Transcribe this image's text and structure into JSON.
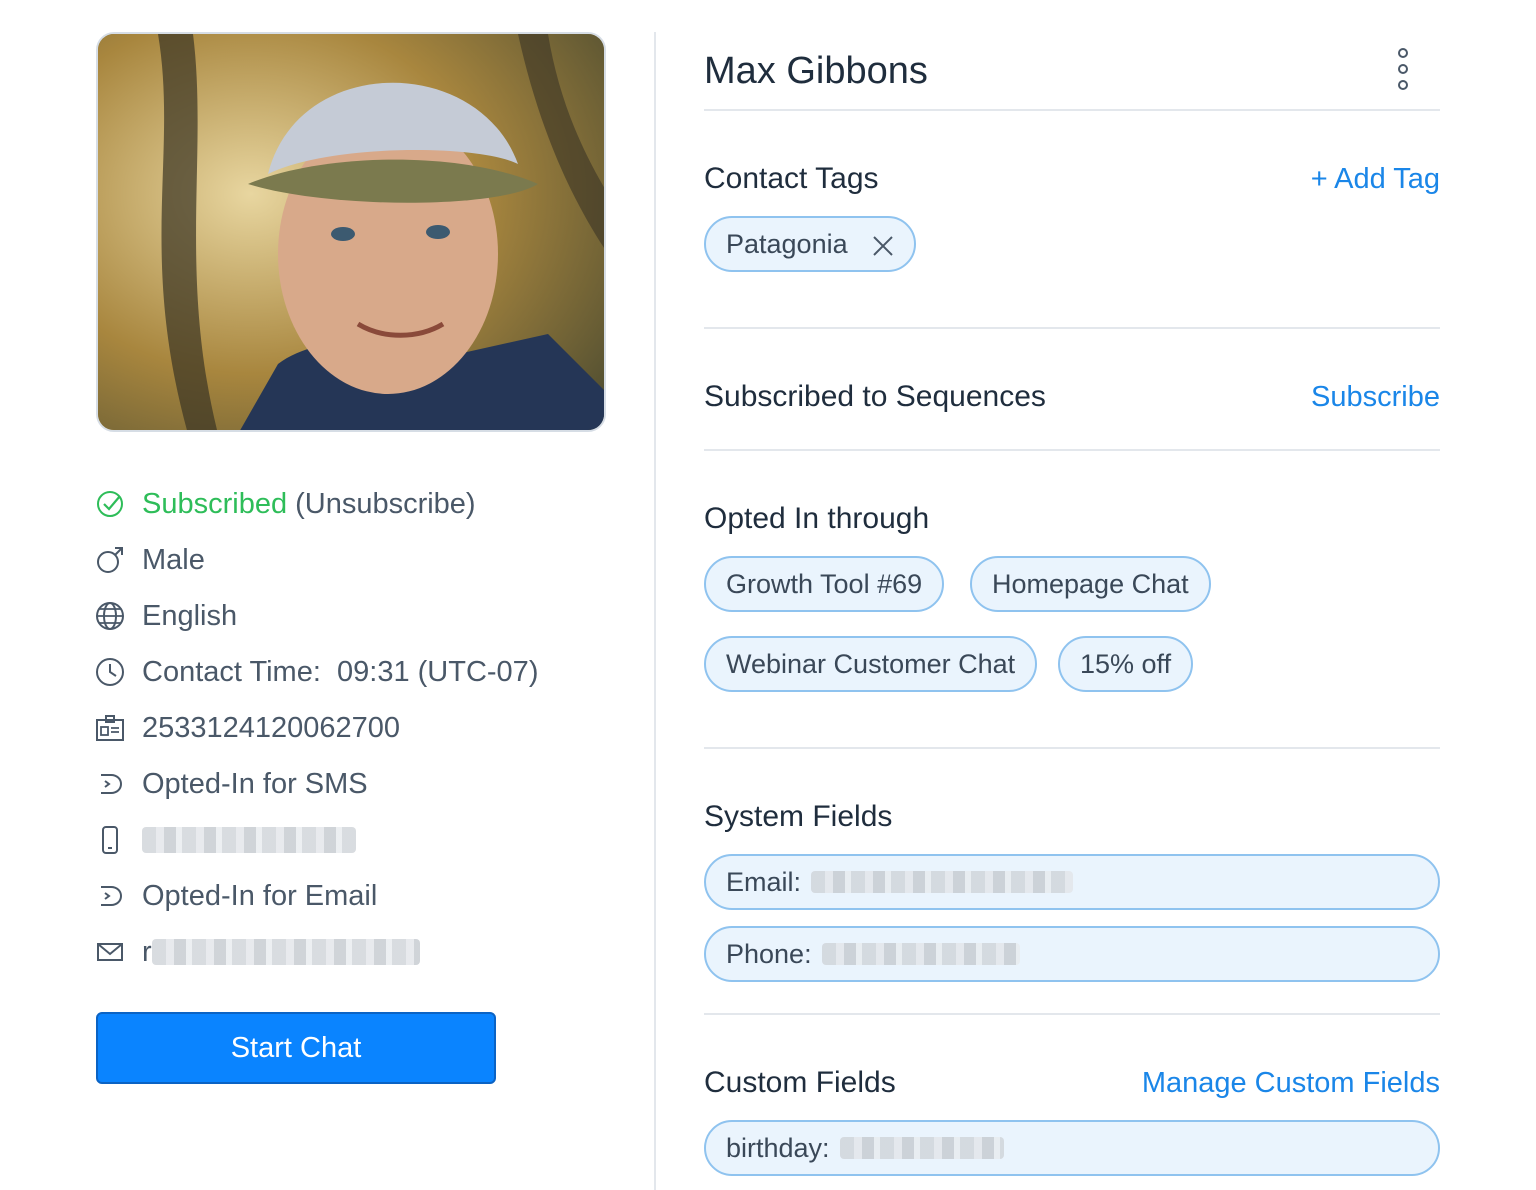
{
  "profile": {
    "subscribed_label": "Subscribed",
    "unsubscribe_label": "(Unsubscribe)",
    "gender": "Male",
    "language": "English",
    "contact_time": "Contact Time:  09:31 (UTC-07)",
    "contact_id": "2533124120062700",
    "sms_optin": "Opted-In for SMS",
    "email_optin": "Opted-In for Email",
    "email_prefix": "r",
    "start_chat_label": "Start Chat"
  },
  "header": {
    "name": "Max Gibbons"
  },
  "contact_tags": {
    "title": "Contact Tags",
    "add_label": "+ Add Tag",
    "tags": [
      "Patagonia"
    ]
  },
  "sequences": {
    "title": "Subscribed to Sequences",
    "link_label": "Subscribe"
  },
  "opted_in": {
    "title": "Opted In through",
    "items": [
      "Growth Tool #69",
      "Homepage Chat",
      "Webinar Customer Chat",
      "15% off"
    ]
  },
  "system_fields": {
    "title": "System Fields",
    "email_label": "Email:",
    "phone_label": "Phone:"
  },
  "custom_fields": {
    "title": "Custom Fields",
    "link_label": "Manage Custom Fields",
    "birthday_label": "birthday:"
  },
  "colors": {
    "accent": "#1a86e8",
    "button": "#0a84ff",
    "success": "#2ebd59",
    "chip_border": "#8fc3ef",
    "chip_bg": "#eaf4fd"
  },
  "icons": [
    "check-circle-icon",
    "male-icon",
    "globe-icon",
    "clock-icon",
    "id-card-icon",
    "opt-in-icon",
    "phone-icon",
    "mail-icon",
    "close-icon",
    "kebab-menu-icon"
  ]
}
